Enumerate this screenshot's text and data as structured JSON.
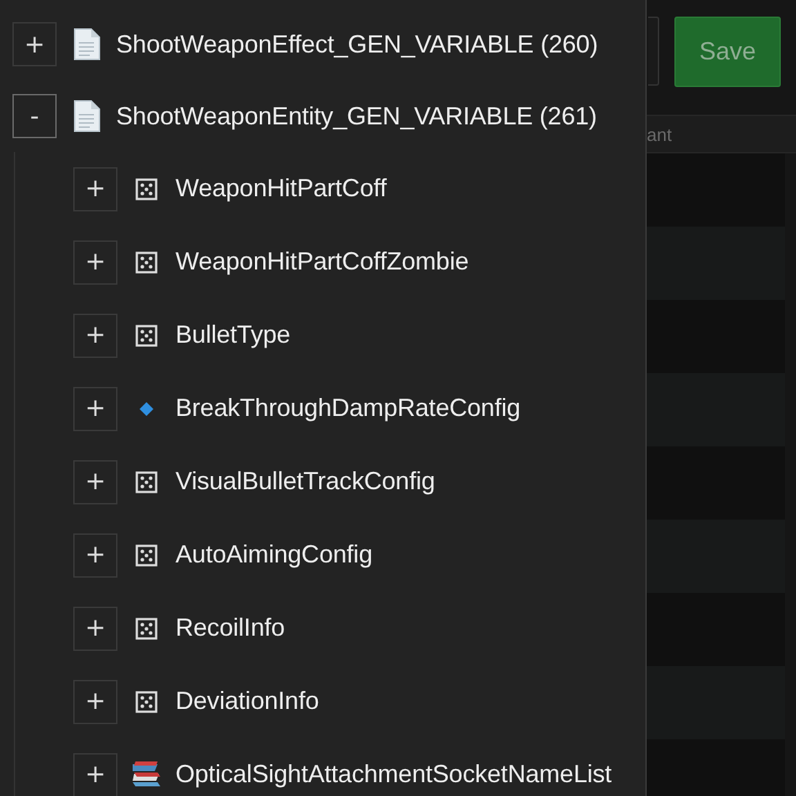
{
  "toolbar": {
    "save_button": "Save"
  },
  "table": {
    "columns": [
      "ant"
    ]
  },
  "tree": [
    {
      "toggle": "+",
      "expanded": false,
      "kind": "document",
      "label": "ShootWeaponEffect_GEN_VARIABLE (260)"
    },
    {
      "toggle": "-",
      "expanded": true,
      "kind": "document",
      "label": "ShootWeaponEntity_GEN_VARIABLE (261)",
      "children": [
        {
          "toggle": "+",
          "expanded": false,
          "kind": "dice",
          "label": "WeaponHitPartCoff"
        },
        {
          "toggle": "+",
          "expanded": false,
          "kind": "dice",
          "label": "WeaponHitPartCoffZombie"
        },
        {
          "toggle": "+",
          "expanded": false,
          "kind": "dice",
          "label": "BulletType"
        },
        {
          "toggle": "+",
          "expanded": false,
          "kind": "diamond",
          "label": "BreakThroughDampRateConfig"
        },
        {
          "toggle": "+",
          "expanded": false,
          "kind": "dice",
          "label": "VisualBulletTrackConfig"
        },
        {
          "toggle": "+",
          "expanded": false,
          "kind": "dice",
          "label": "AutoAimingConfig"
        },
        {
          "toggle": "+",
          "expanded": false,
          "kind": "dice",
          "label": "RecoilInfo"
        },
        {
          "toggle": "+",
          "expanded": false,
          "kind": "dice",
          "label": "DeviationInfo"
        },
        {
          "toggle": "+",
          "expanded": false,
          "kind": "books",
          "label": "OpticalSightAttachmentSocketNameList"
        }
      ]
    }
  ]
}
